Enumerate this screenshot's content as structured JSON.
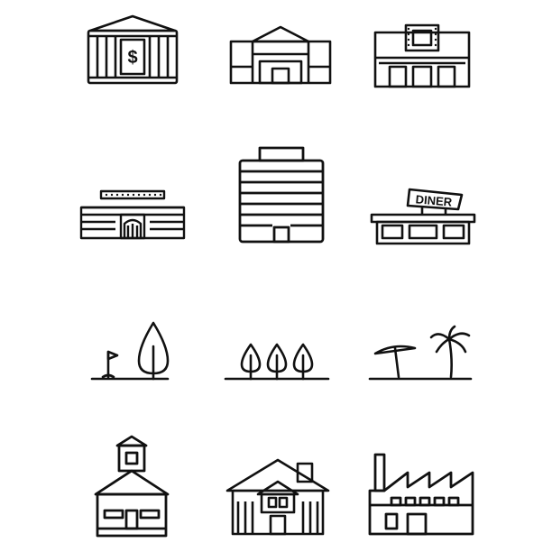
{
  "palette": {
    "stroke": "#111111",
    "background": "#ffffff"
  },
  "icons": [
    {
      "name": "bank",
      "icon": "bank-icon",
      "sign": "$"
    },
    {
      "name": "shopping-mall",
      "icon": "mall-icon"
    },
    {
      "name": "movie-theater",
      "icon": "theater-icon"
    },
    {
      "name": "stadium",
      "icon": "stadium-icon"
    },
    {
      "name": "office-tower",
      "icon": "office-building-icon"
    },
    {
      "name": "diner",
      "icon": "diner-icon",
      "sign": "DINER"
    },
    {
      "name": "golf-and-tree",
      "icon": "golf-park-icon"
    },
    {
      "name": "tree-row",
      "icon": "trees-icon"
    },
    {
      "name": "beach",
      "icon": "beach-palm-icon"
    },
    {
      "name": "schoolhouse",
      "icon": "school-icon"
    },
    {
      "name": "house",
      "icon": "house-icon"
    },
    {
      "name": "factory",
      "icon": "factory-icon"
    }
  ]
}
